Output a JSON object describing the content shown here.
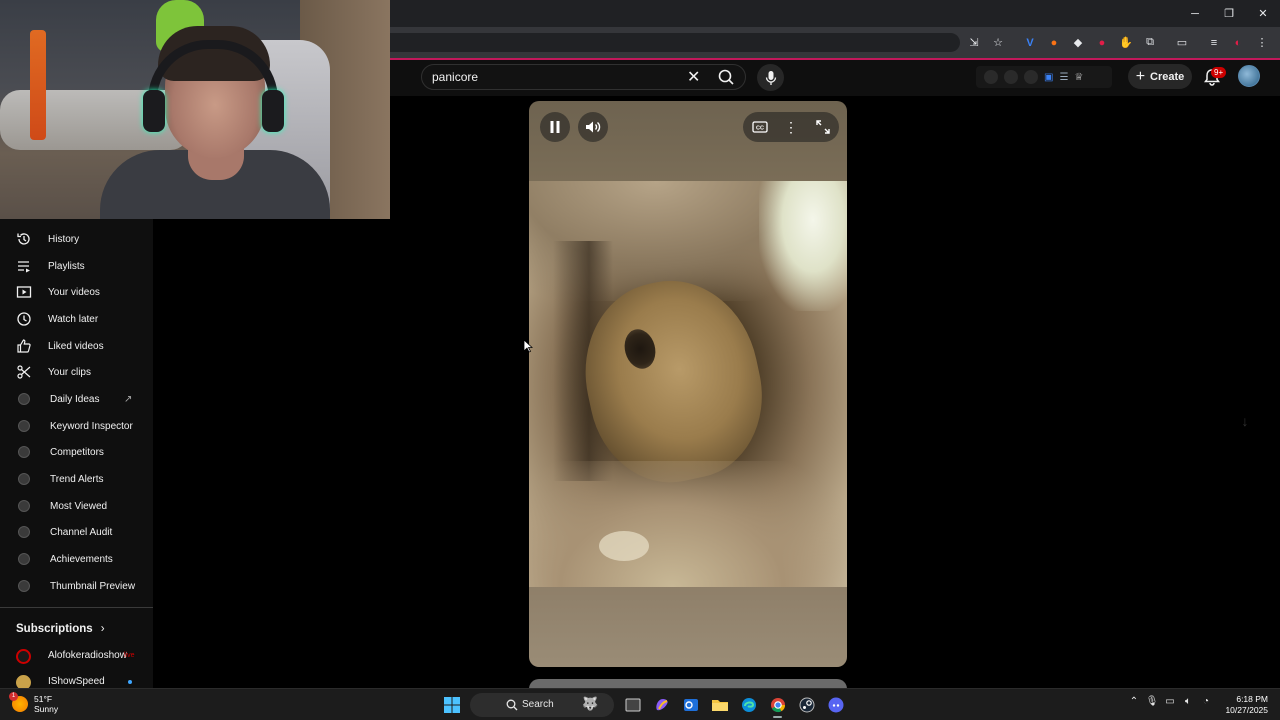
{
  "search": {
    "query": "panicore"
  },
  "header": {
    "create_label": "Create",
    "notif_count": "9+"
  },
  "sidebar": {
    "items": [
      {
        "label": "History",
        "icon": "history-icon"
      },
      {
        "label": "Playlists",
        "icon": "playlists-icon"
      },
      {
        "label": "Your videos",
        "icon": "your-videos-icon"
      },
      {
        "label": "Watch later",
        "icon": "watch-later-icon"
      },
      {
        "label": "Liked videos",
        "icon": "liked-videos-icon"
      },
      {
        "label": "Your clips",
        "icon": "scissors-icon"
      }
    ],
    "extension_items": [
      {
        "label": "Daily Ideas",
        "external": "↗"
      },
      {
        "label": "Keyword Inspector"
      },
      {
        "label": "Competitors"
      },
      {
        "label": "Trend Alerts"
      },
      {
        "label": "Most Viewed"
      },
      {
        "label": "Channel Audit"
      },
      {
        "label": "Achievements"
      },
      {
        "label": "Thumbnail Preview"
      }
    ],
    "subscriptions_title": "Subscriptions",
    "subscriptions": [
      {
        "name": "Alofokeradioshow",
        "live": "live",
        "color": "#cc0000"
      },
      {
        "name": "IShowSpeed",
        "color": "#c9a24a"
      }
    ]
  },
  "taskbar": {
    "weather_temp": "51°F",
    "weather_desc": "Sunny",
    "weather_badge": "1",
    "search_label": "Search",
    "time": "6:18 PM",
    "date": "10/27/2025"
  },
  "colors": {
    "accent": "#cc0000",
    "bg": "#0f0f0f",
    "browser_accent_line": "#c2185b"
  }
}
